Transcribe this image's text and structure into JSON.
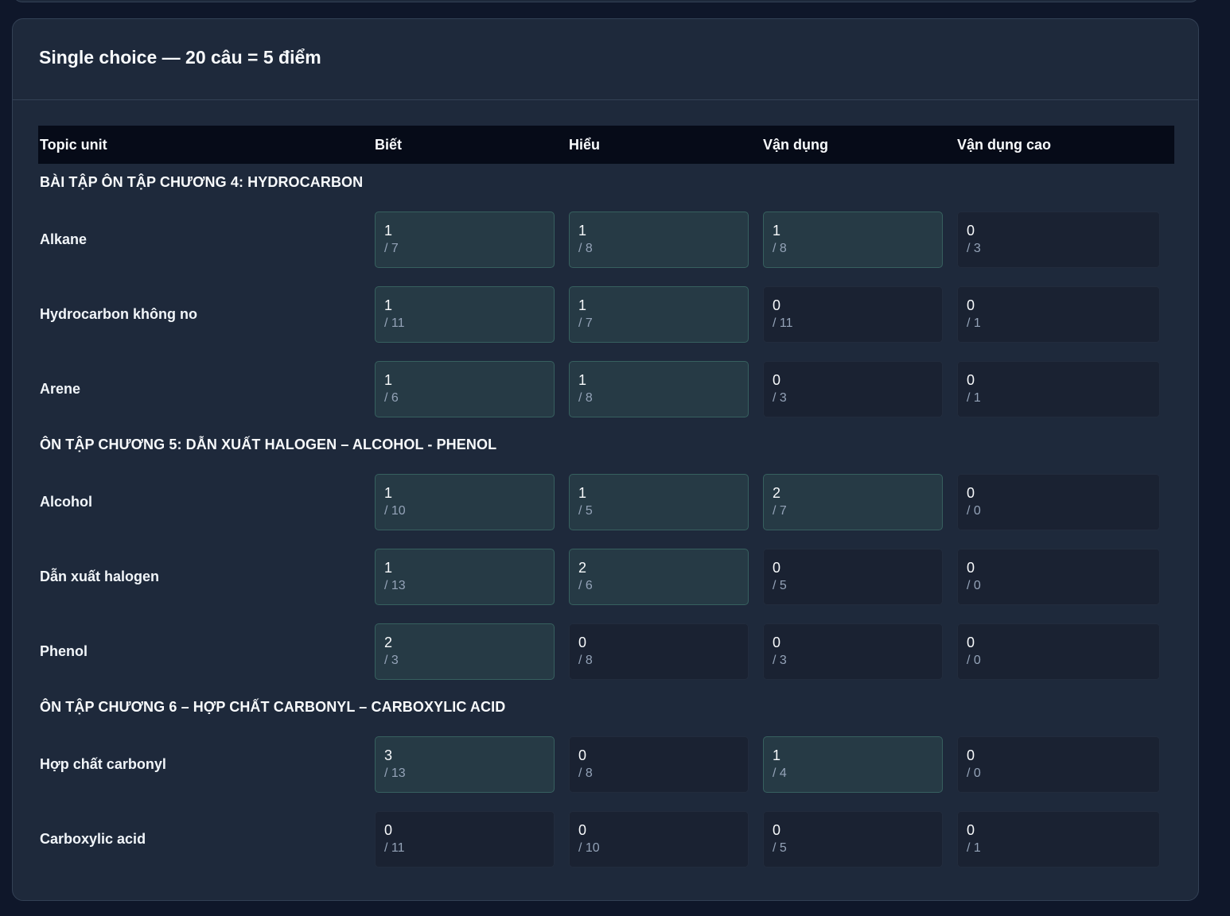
{
  "section": {
    "title": "Single choice — 20 câu = 5 điểm"
  },
  "table": {
    "headers": {
      "topic": "Topic unit",
      "levels": [
        "Biết",
        "Hiểu",
        "Vận dụng",
        "Vận dụng cao"
      ]
    },
    "groups": [
      {
        "title": "BÀI TẬP ÔN TẬP CHƯƠNG 4: HYDROCARBON",
        "topics": [
          {
            "name": "Alkane",
            "cells": [
              {
                "value": "1",
                "max": "/ 7",
                "active": true
              },
              {
                "value": "1",
                "max": "/ 8",
                "active": true
              },
              {
                "value": "1",
                "max": "/ 8",
                "active": true
              },
              {
                "value": "0",
                "max": "/ 3",
                "active": false
              }
            ]
          },
          {
            "name": "Hydrocarbon không no",
            "cells": [
              {
                "value": "1",
                "max": "/ 11",
                "active": true
              },
              {
                "value": "1",
                "max": "/ 7",
                "active": true
              },
              {
                "value": "0",
                "max": "/ 11",
                "active": false
              },
              {
                "value": "0",
                "max": "/ 1",
                "active": false
              }
            ]
          },
          {
            "name": "Arene",
            "cells": [
              {
                "value": "1",
                "max": "/ 6",
                "active": true
              },
              {
                "value": "1",
                "max": "/ 8",
                "active": true
              },
              {
                "value": "0",
                "max": "/ 3",
                "active": false
              },
              {
                "value": "0",
                "max": "/ 1",
                "active": false
              }
            ]
          }
        ]
      },
      {
        "title": "ÔN TẬP CHƯƠNG 5: DẪN XUẤT HALOGEN – ALCOHOL - PHENOL",
        "topics": [
          {
            "name": "Alcohol",
            "cells": [
              {
                "value": "1",
                "max": "/ 10",
                "active": true
              },
              {
                "value": "1",
                "max": "/ 5",
                "active": true
              },
              {
                "value": "2",
                "max": "/ 7",
                "active": true
              },
              {
                "value": "0",
                "max": "/ 0",
                "active": false
              }
            ]
          },
          {
            "name": "Dẫn xuất halogen",
            "cells": [
              {
                "value": "1",
                "max": "/ 13",
                "active": true
              },
              {
                "value": "2",
                "max": "/ 6",
                "active": true
              },
              {
                "value": "0",
                "max": "/ 5",
                "active": false
              },
              {
                "value": "0",
                "max": "/ 0",
                "active": false
              }
            ]
          },
          {
            "name": "Phenol",
            "cells": [
              {
                "value": "2",
                "max": "/ 3",
                "active": true
              },
              {
                "value": "0",
                "max": "/ 8",
                "active": false
              },
              {
                "value": "0",
                "max": "/ 3",
                "active": false
              },
              {
                "value": "0",
                "max": "/ 0",
                "active": false
              }
            ]
          }
        ]
      },
      {
        "title": "ÔN TẬP CHƯƠNG 6 – HỢP CHẤT CARBONYL – CARBOXYLIC ACID",
        "topics": [
          {
            "name": "Hợp chất carbonyl",
            "cells": [
              {
                "value": "3",
                "max": "/ 13",
                "active": true
              },
              {
                "value": "0",
                "max": "/ 8",
                "active": false
              },
              {
                "value": "1",
                "max": "/ 4",
                "active": true
              },
              {
                "value": "0",
                "max": "/ 0",
                "active": false
              }
            ]
          },
          {
            "name": "Carboxylic acid",
            "cells": [
              {
                "value": "0",
                "max": "/ 11",
                "active": false
              },
              {
                "value": "0",
                "max": "/ 10",
                "active": false
              },
              {
                "value": "0",
                "max": "/ 5",
                "active": false
              },
              {
                "value": "0",
                "max": "/ 1",
                "active": false
              }
            ]
          }
        ]
      }
    ]
  },
  "colors": {
    "page_bg": "#0f172a",
    "card_bg": "#1e293b",
    "header_bg": "#060b18",
    "active_cell_bg": "#263a45",
    "active_cell_border": "#37605f",
    "inactive_cell_bg": "#1a2232"
  }
}
